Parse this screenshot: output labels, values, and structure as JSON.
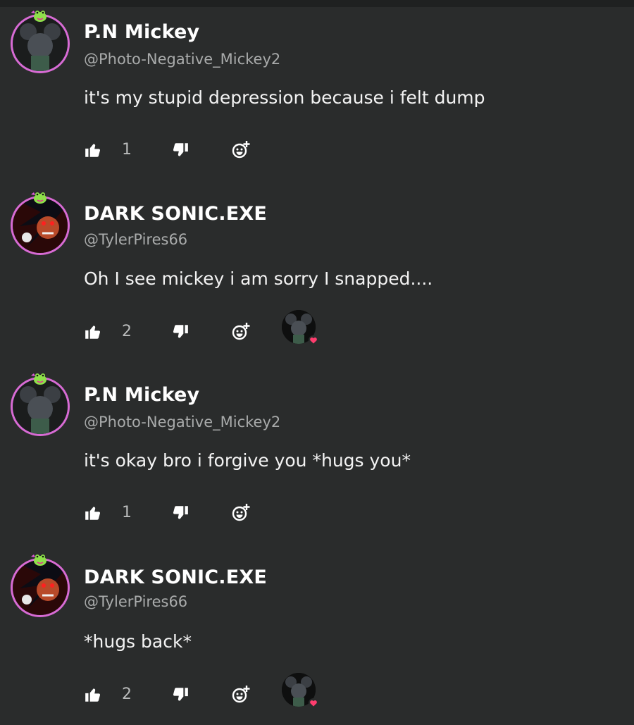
{
  "comments": [
    {
      "name": "P.N Mickey",
      "handle": "@Photo-Negative_Mickey2",
      "text": "it's my stupid depression because i felt dump",
      "likes": "1",
      "avatar": "mickey",
      "has_reaction": false
    },
    {
      "name": "DARK SONIC.EXE",
      "handle": "@TylerPires66",
      "text": "Oh I see mickey i am sorry I snapped....",
      "likes": "2",
      "avatar": "sonic",
      "has_reaction": true
    },
    {
      "name": "P.N Mickey",
      "handle": "@Photo-Negative_Mickey2",
      "text": "it's okay bro i forgive you *hugs you*",
      "likes": "1",
      "avatar": "mickey",
      "has_reaction": false
    },
    {
      "name": "DARK SONIC.EXE",
      "handle": "@TylerPires66",
      "text": "*hugs back*",
      "likes": "2",
      "avatar": "sonic",
      "has_reaction": true
    }
  ],
  "icons": {
    "like": "thumbs-up-icon",
    "dislike": "thumbs-down-icon",
    "react": "add-reaction-icon",
    "badge": "frog-badge-icon",
    "heart": "heart-icon"
  },
  "colors": {
    "background": "#2a2c2c",
    "avatar_ring": "#d86bd4",
    "heart": "#ff3d6e",
    "muted_text": "#a9abab"
  }
}
